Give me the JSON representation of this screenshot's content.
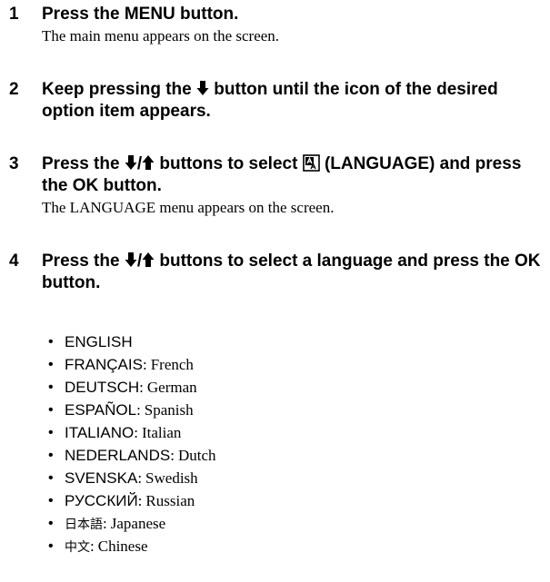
{
  "steps": [
    {
      "number": "1",
      "heading": "Press the MENU button.",
      "description": "The main menu appears on the screen."
    },
    {
      "number": "2",
      "heading_before": "Keep pressing the",
      "heading_after": "button until the icon of the desired option item appears."
    },
    {
      "number": "3",
      "heading_before": "Press the",
      "slash": "/",
      "heading_middle": "buttons to select",
      "heading_after": "(LANGUAGE) and press the OK button.",
      "description": "The LANGUAGE menu appears on the screen."
    },
    {
      "number": "4",
      "heading_before": "Press the",
      "slash": "/",
      "heading_after": "buttons to select a language and press the OK button."
    }
  ],
  "icons": {
    "down": "down-arrow-icon",
    "up": "up-arrow-icon",
    "language": "language-icon"
  },
  "bullet": "•",
  "languages": [
    {
      "name": "ENGLISH",
      "separator": "",
      "english": ""
    },
    {
      "name": "FRANÇAIS",
      "separator": ":",
      "english": "French"
    },
    {
      "name": "DEUTSCH",
      "separator": ":",
      "english": "German"
    },
    {
      "name": "ESPAÑOL",
      "separator": ":",
      "english": "Spanish"
    },
    {
      "name": "ITALIANO",
      "separator": ":",
      "english": "Italian"
    },
    {
      "name": "NEDERLANDS",
      "separator": ":",
      "english": "Dutch"
    },
    {
      "name": "SVENSKA",
      "separator": ":",
      "english": "Swedish"
    },
    {
      "name": "РУССКИЙ",
      "separator": ":",
      "english": "Russian"
    },
    {
      "name": "日本語",
      "separator": ":",
      "english": "Japanese"
    },
    {
      "name": "中文",
      "separator": ":",
      "english": "Chinese"
    }
  ]
}
